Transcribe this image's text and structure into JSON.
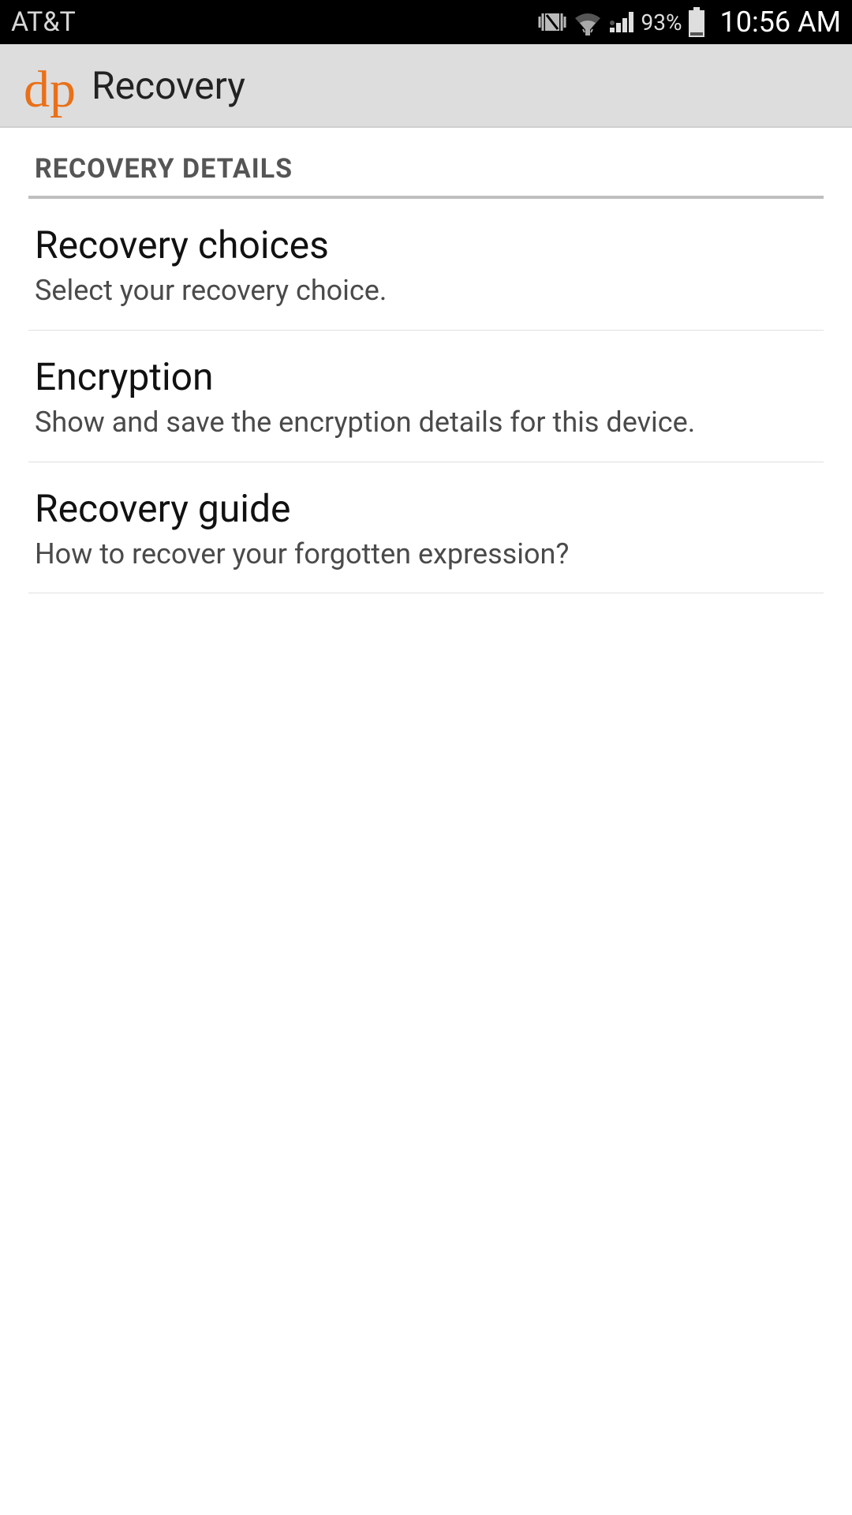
{
  "status_bar": {
    "carrier": "AT&T",
    "battery_pct": "93%",
    "time": "10:56 AM"
  },
  "app_bar": {
    "logo_text": "dp",
    "title": "Recovery"
  },
  "section_header": "RECOVERY DETAILS",
  "items": [
    {
      "title": "Recovery choices",
      "desc": "Select your recovery choice."
    },
    {
      "title": "Encryption",
      "desc": "Show and save the encryption details for this device."
    },
    {
      "title": "Recovery guide",
      "desc": "How to recover your forgotten expression?"
    }
  ]
}
